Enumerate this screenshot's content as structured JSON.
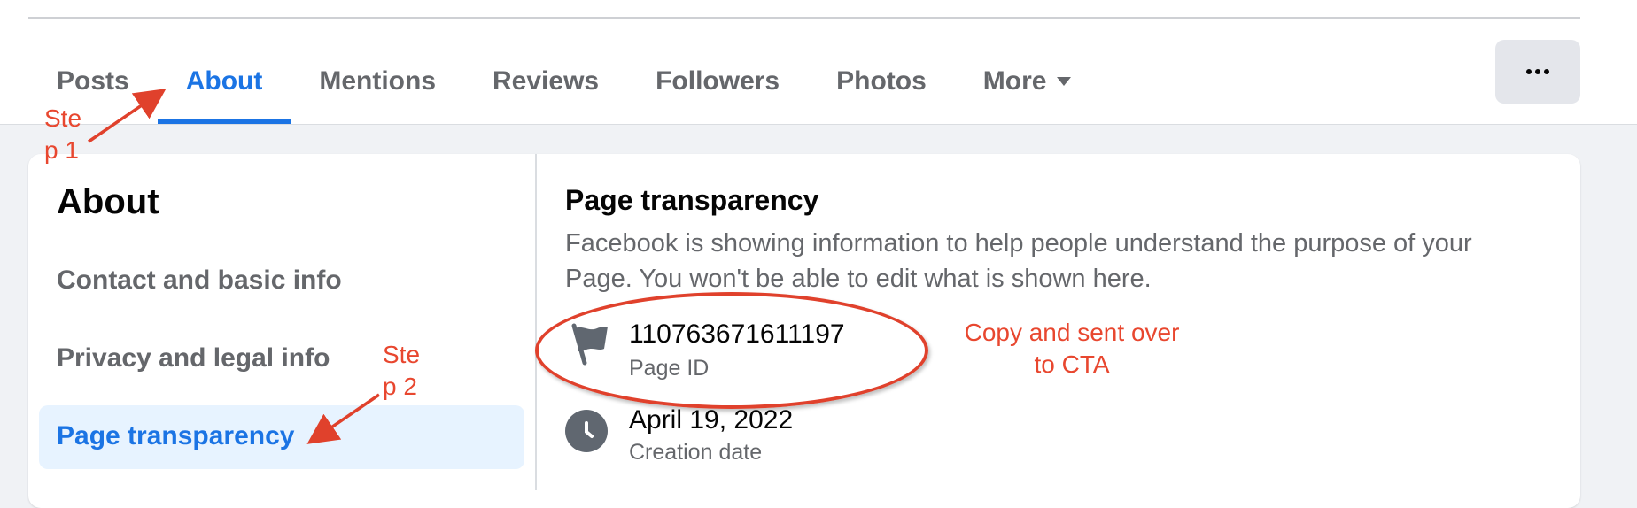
{
  "tabs": [
    {
      "label": "Posts"
    },
    {
      "label": "About"
    },
    {
      "label": "Mentions"
    },
    {
      "label": "Reviews"
    },
    {
      "label": "Followers"
    },
    {
      "label": "Photos"
    },
    {
      "label": "More"
    }
  ],
  "sidebar": {
    "title": "About",
    "items": [
      {
        "label": "Contact and basic info"
      },
      {
        "label": "Privacy and legal info"
      },
      {
        "label": "Page transparency"
      }
    ]
  },
  "main": {
    "title": "Page transparency",
    "description": "Facebook is showing information to help people understand the purpose of your Page. You won't be able to edit what is shown here.",
    "page_id": {
      "value": "110763671611197",
      "label": "Page ID"
    },
    "creation": {
      "value": "April 19, 2022",
      "label": "Creation date"
    }
  },
  "annotations": {
    "step1_line1": "Ste",
    "step1_line2": "p 1",
    "step2_line1": "Ste",
    "step2_line2": "p 2",
    "note_line1": "Copy and sent over",
    "note_line2": "to CTA"
  },
  "colors": {
    "accent": "#1b74e4",
    "annotation": "#e8472f"
  }
}
